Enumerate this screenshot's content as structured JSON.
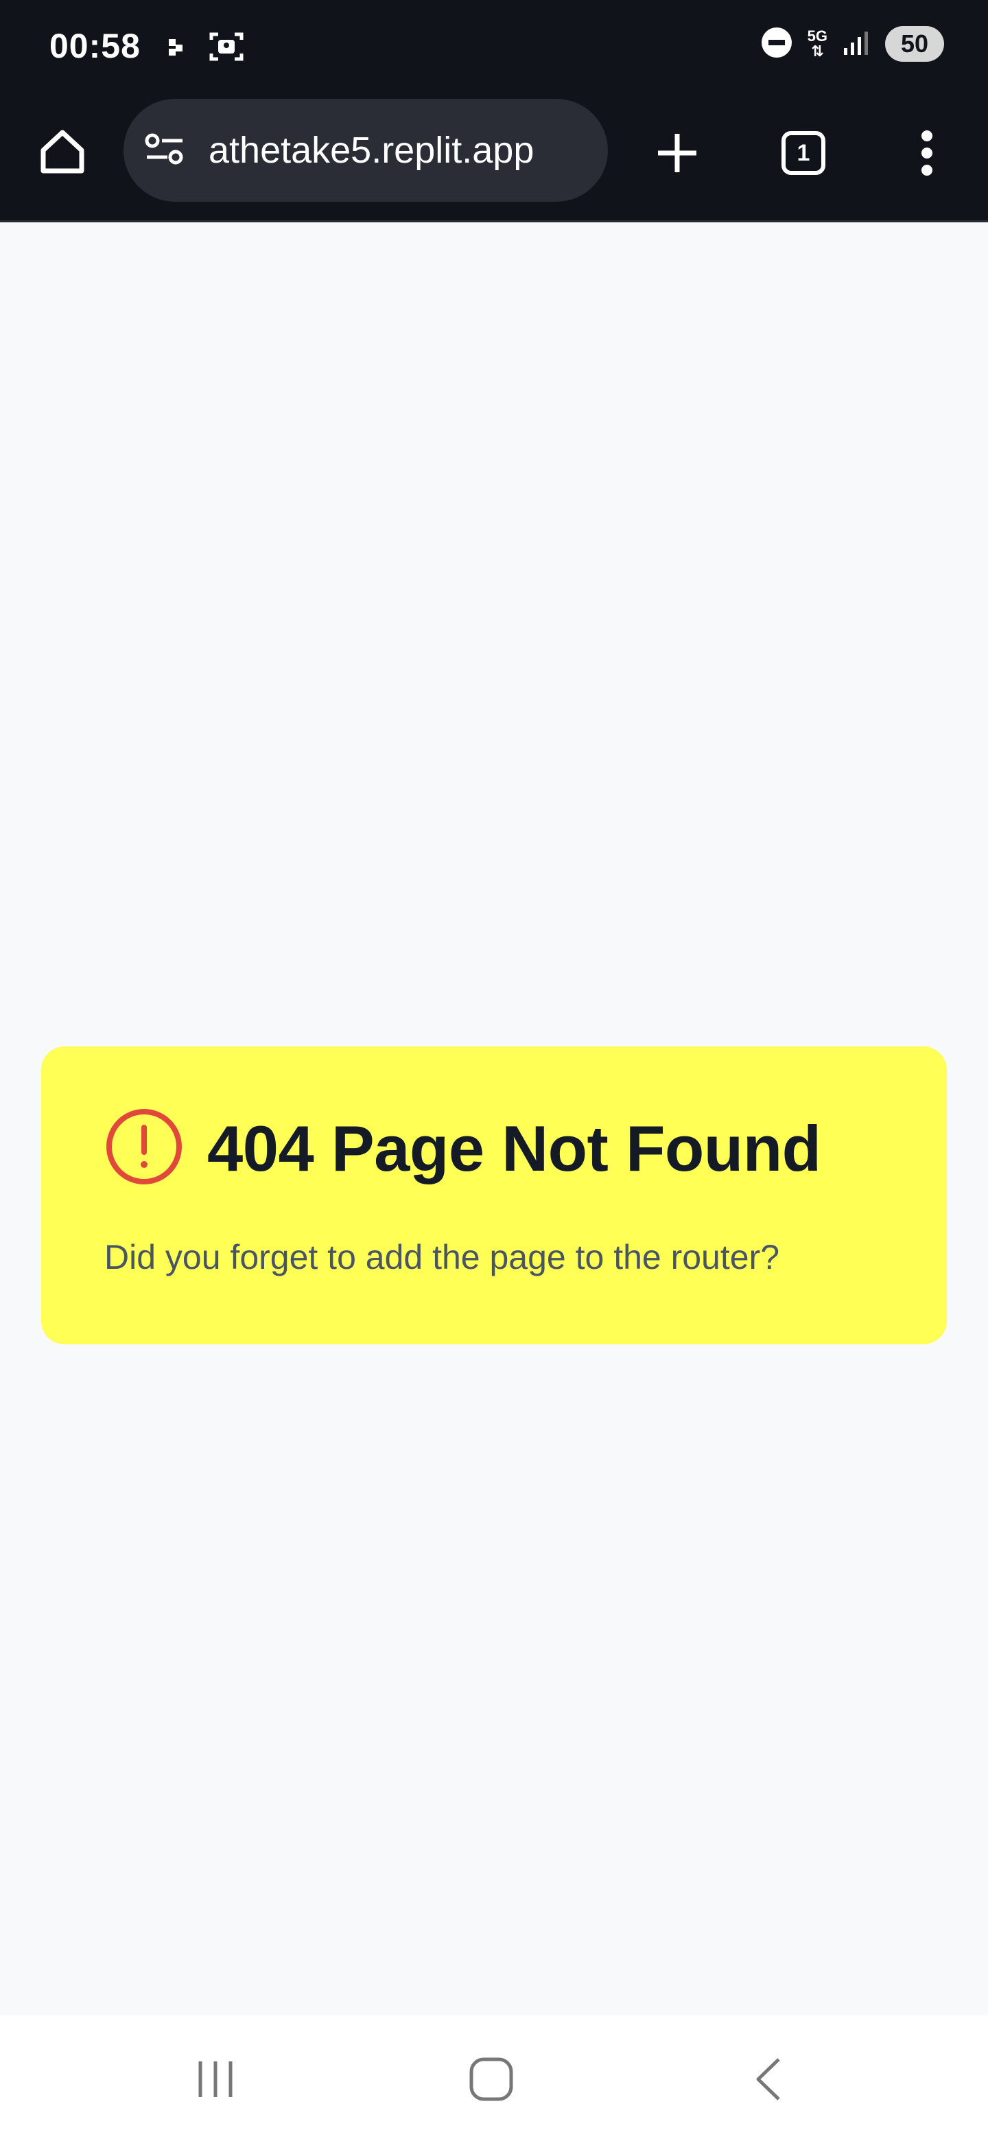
{
  "status_bar": {
    "time": "00:58",
    "network": "5G",
    "battery": "50"
  },
  "browser": {
    "url": "athetake5.replit.app",
    "tab_count": "1"
  },
  "error_card": {
    "title": "404 Page Not Found",
    "message": "Did you forget to add the page to the router?"
  },
  "colors": {
    "card_background": "#ffff55",
    "alert_icon": "#e0483c",
    "title_text": "#141a26",
    "toolbar_background": "#11131a"
  }
}
